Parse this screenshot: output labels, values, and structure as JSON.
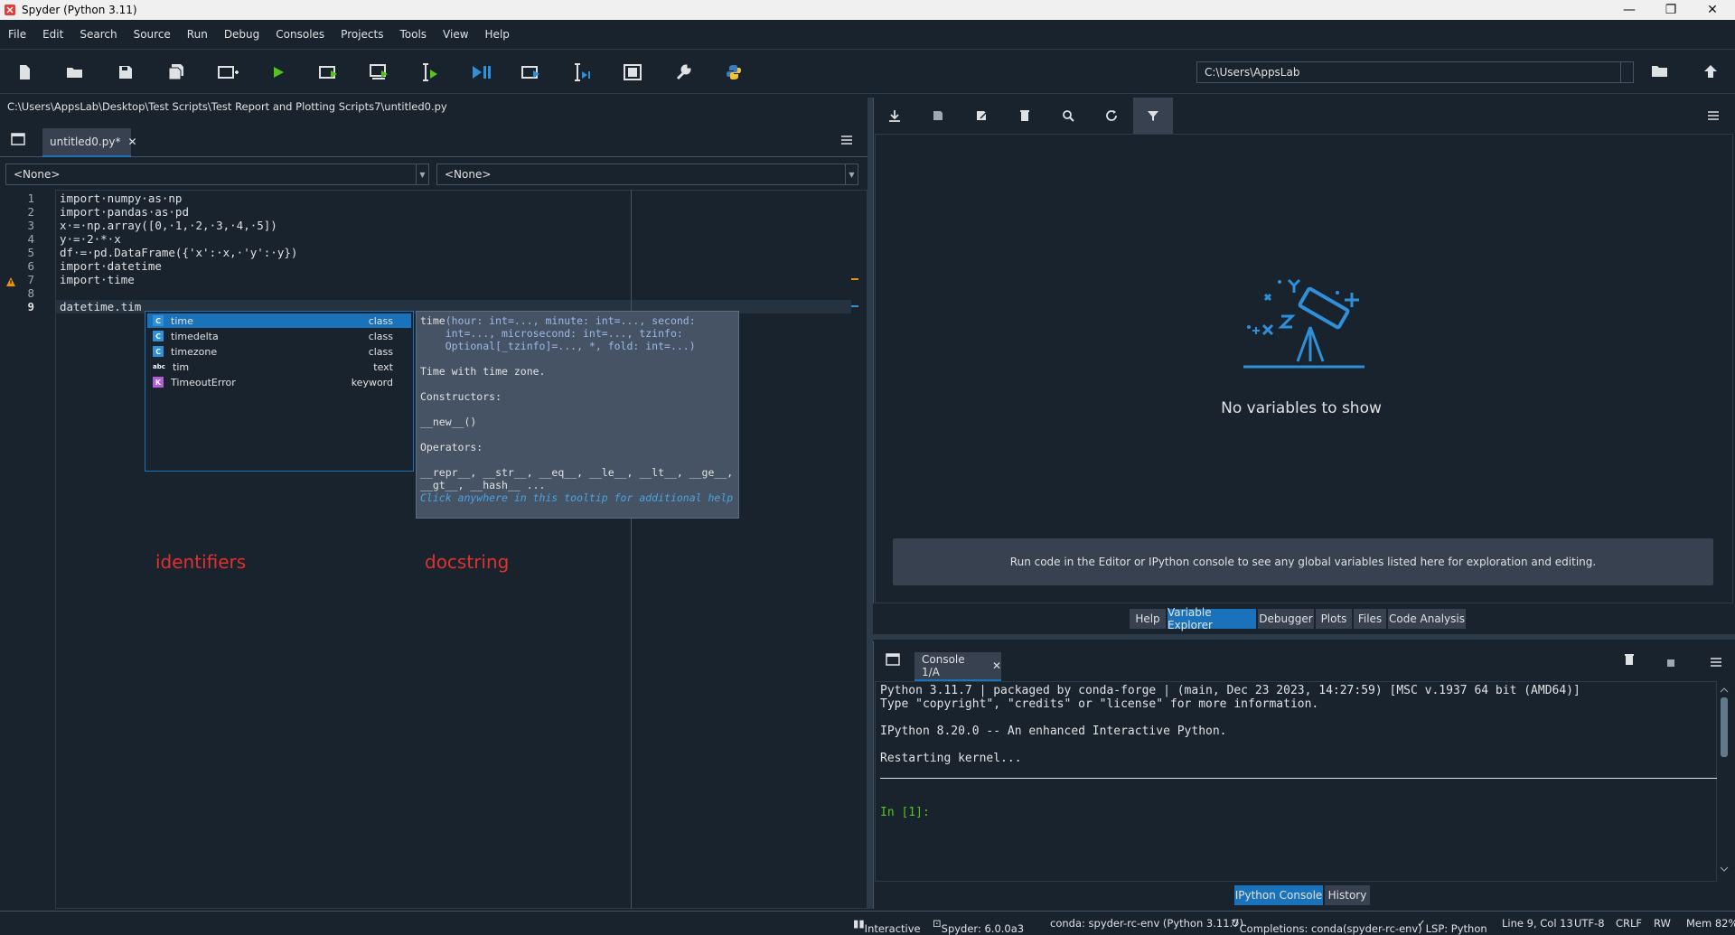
{
  "window": {
    "title": "Spyder (Python 3.11)",
    "minimize": "—",
    "maximize": "❐",
    "close": "✕"
  },
  "menu": [
    "File",
    "Edit",
    "Search",
    "Source",
    "Run",
    "Debug",
    "Consoles",
    "Projects",
    "Tools",
    "View",
    "Help"
  ],
  "toolbar": {
    "path": "C:\\Users\\AppsLab"
  },
  "editor": {
    "file_path": "C:\\Users\\AppsLab\\Desktop\\Test Scripts\\Test Report and Plotting Scripts7\\untitled0.py",
    "tab_label": "untitled0.py*",
    "class_combo": "<None>",
    "func_combo": "<None>",
    "line_numbers": [
      "1",
      "2",
      "3",
      "4",
      "5",
      "6",
      "7",
      "8",
      "9"
    ],
    "lines": [
      "import·numpy·as·np",
      "import·pandas·as·pd",
      "x·=·np.array([0,·1,·2,·3,·4,·5])",
      "y·=·2·*·x",
      "df·=·pd.DataFrame({'x':·x,·'y':·y})",
      "import·datetime",
      "import·time",
      "",
      "datetime.tim"
    ]
  },
  "completion": {
    "items": [
      {
        "icon": "C",
        "name": "time",
        "kind": "class",
        "color": "#2f8fd8"
      },
      {
        "icon": "C",
        "name": "timedelta",
        "kind": "class",
        "color": "#2f8fd8"
      },
      {
        "icon": "C",
        "name": "timezone",
        "kind": "class",
        "color": "#2f8fd8"
      },
      {
        "icon": "abc",
        "name": "tim",
        "kind": "text",
        "color": "#19232d"
      },
      {
        "icon": "K",
        "name": "TimeoutError",
        "kind": "keyword",
        "color": "#b55dd6"
      }
    ]
  },
  "docstring": {
    "sig1_name": "time",
    "sig1": "(hour: int=..., minute: int=..., second:",
    "sig2": "    int=..., microsecond: int=..., tzinfo:",
    "sig3": "    Optional[_tzinfo]=..., *, fold: int=...)",
    "desc": "Time with time zone.",
    "constructors_label": "Constructors:",
    "constructors": "__new__()",
    "operators_label": "Operators:",
    "operators1": "__repr__, __str__, __eq__, __le__, __lt__, __ge__,",
    "operators2": "__gt__, __hash__ ...",
    "hint": "Click anywhere in this tooltip for additional help"
  },
  "annotations": {
    "left": "identifiers",
    "right": "docstring"
  },
  "variable_explorer": {
    "empty_title": "No variables to show",
    "empty_hint": "Run code in the Editor or IPython console to see any global variables listed here for exploration and editing."
  },
  "pane_tabs": [
    "Help",
    "Variable Explorer",
    "Debugger",
    "Plots",
    "Files",
    "Code Analysis"
  ],
  "console": {
    "tab_label": "Console 1/A",
    "line1": "Python 3.11.7 | packaged by conda-forge | (main, Dec 23 2023, 14:27:59) [MSC v.1937 64 bit (AMD64)]",
    "line2": "Type \"copyright\", \"credits\" or \"license\" for more information.",
    "line3": "IPython 8.20.0 -- An enhanced Interactive Python.",
    "line4": "Restarting kernel...",
    "prompt": "In [1]:",
    "tabs": [
      "IPython Console",
      "History"
    ]
  },
  "status": {
    "mode": "Interactive",
    "spyder": "Spyder: 6.0.0a3",
    "env": "conda: spyder-rc-env (Python 3.11.7)",
    "completions": "Completions: conda(spyder-rc-env)",
    "lsp": "LSP: Python",
    "position": "Line 9, Col 13",
    "encoding": "UTF-8",
    "eol": "CRLF",
    "perm": "RW",
    "mem": "Mem 82%"
  },
  "colors": {
    "background": "#19232d",
    "accent": "#1a72bb",
    "run_green": "#54c61a",
    "annotation_red": "#e03131"
  }
}
